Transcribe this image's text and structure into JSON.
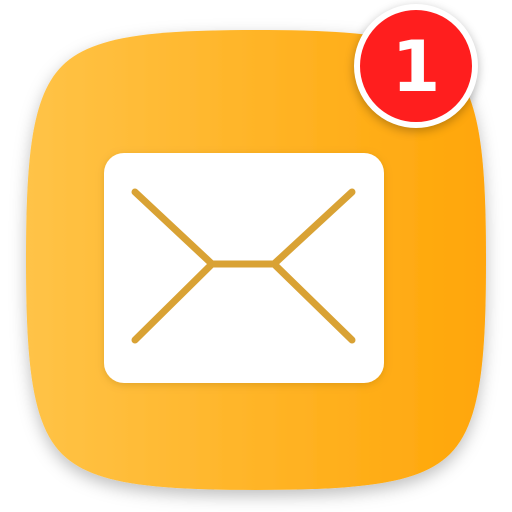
{
  "app": {
    "name": "Mail",
    "icon": "envelope-icon",
    "colors": {
      "gradient_start": "#FFC347",
      "gradient_end": "#FFA608",
      "envelope_fill": "#FFFFFF",
      "envelope_lines": "#D9A234",
      "badge": "#FF1E1E"
    }
  },
  "badge": {
    "count": "1"
  }
}
